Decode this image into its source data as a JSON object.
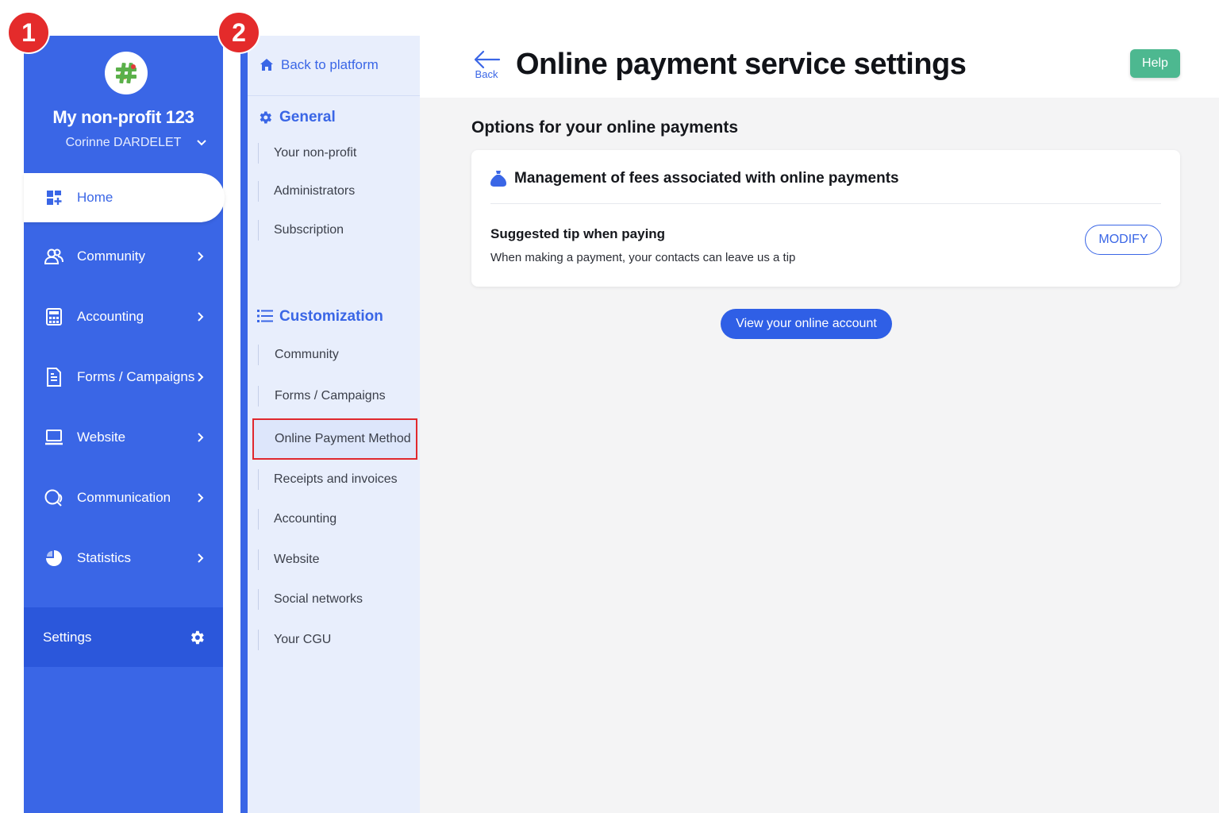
{
  "badges": {
    "step1": "1",
    "step2": "2"
  },
  "sidebar": {
    "org_name": "My non-profit 123",
    "user_name": "Corinne DARDELET",
    "home_label": "Home",
    "items": [
      {
        "label": "Community",
        "icon": "community-icon"
      },
      {
        "label": "Accounting",
        "icon": "calculator-icon"
      },
      {
        "label": "Forms / Campaigns",
        "icon": "document-icon"
      },
      {
        "label": "Website",
        "icon": "laptop-icon"
      },
      {
        "label": "Communication",
        "icon": "chat-icon"
      },
      {
        "label": "Statistics",
        "icon": "pie-chart-icon"
      }
    ],
    "settings_label": "Settings"
  },
  "subnav": {
    "back_label": "Back to platform",
    "general": {
      "heading": "General",
      "links": [
        "Your non-profit",
        "Administrators",
        "Subscription"
      ]
    },
    "customization": {
      "heading": "Customization",
      "links": [
        "Community",
        "Forms / Campaigns",
        "Online Payment Method",
        "Receipts and invoices",
        "Accounting",
        "Website",
        "Social networks",
        "Your CGU"
      ]
    }
  },
  "header": {
    "back_label": "Back",
    "title": "Online payment service settings",
    "help_label": "Help"
  },
  "main": {
    "section_title": "Options for your online payments",
    "card": {
      "title": "Management of fees associated with online payments",
      "tip_title": "Suggested tip when paying",
      "tip_desc": "When making a payment, your contacts can leave us a tip",
      "modify_label": "MODIFY"
    },
    "view_account_label": "View your online account"
  },
  "colors": {
    "primary": "#3a66e6",
    "help": "#4db890",
    "badge": "#e42b2b",
    "highlight": "#e0282e"
  }
}
